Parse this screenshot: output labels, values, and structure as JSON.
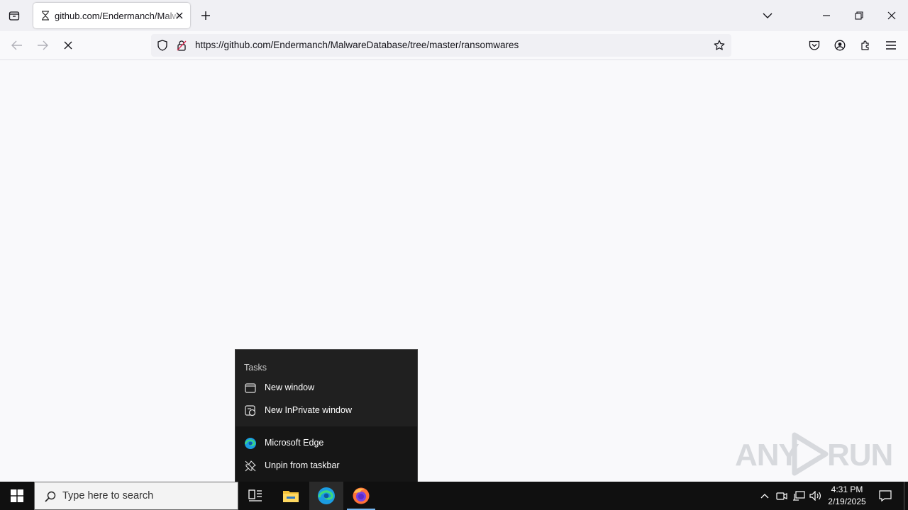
{
  "browser": {
    "tab": {
      "title": "github.com/Endermanch/Malware"
    },
    "url": "https://github.com/Endermanch/MalwareDatabase/tree/master/ransomwares"
  },
  "jumplist": {
    "heading": "Tasks",
    "tasks": [
      {
        "label": "New window",
        "icon": "window-icon"
      },
      {
        "label": "New InPrivate window",
        "icon": "inprivate-icon"
      }
    ],
    "pinned": [
      {
        "label": "Microsoft Edge",
        "icon": "edge-icon"
      },
      {
        "label": "Unpin from taskbar",
        "icon": "unpin-icon"
      }
    ]
  },
  "watermark": {
    "left": "ANY",
    "right": "RUN"
  },
  "taskbar": {
    "search_placeholder": "Type here to search",
    "time": "4:31 PM",
    "date": "2/19/2025",
    "apps": [
      "task-view-icon",
      "file-explorer-icon",
      "edge-icon",
      "firefox-icon"
    ]
  },
  "colors": {
    "accent": "#77b7f0",
    "taskbar": "#101010",
    "jumplist": "#202020"
  }
}
